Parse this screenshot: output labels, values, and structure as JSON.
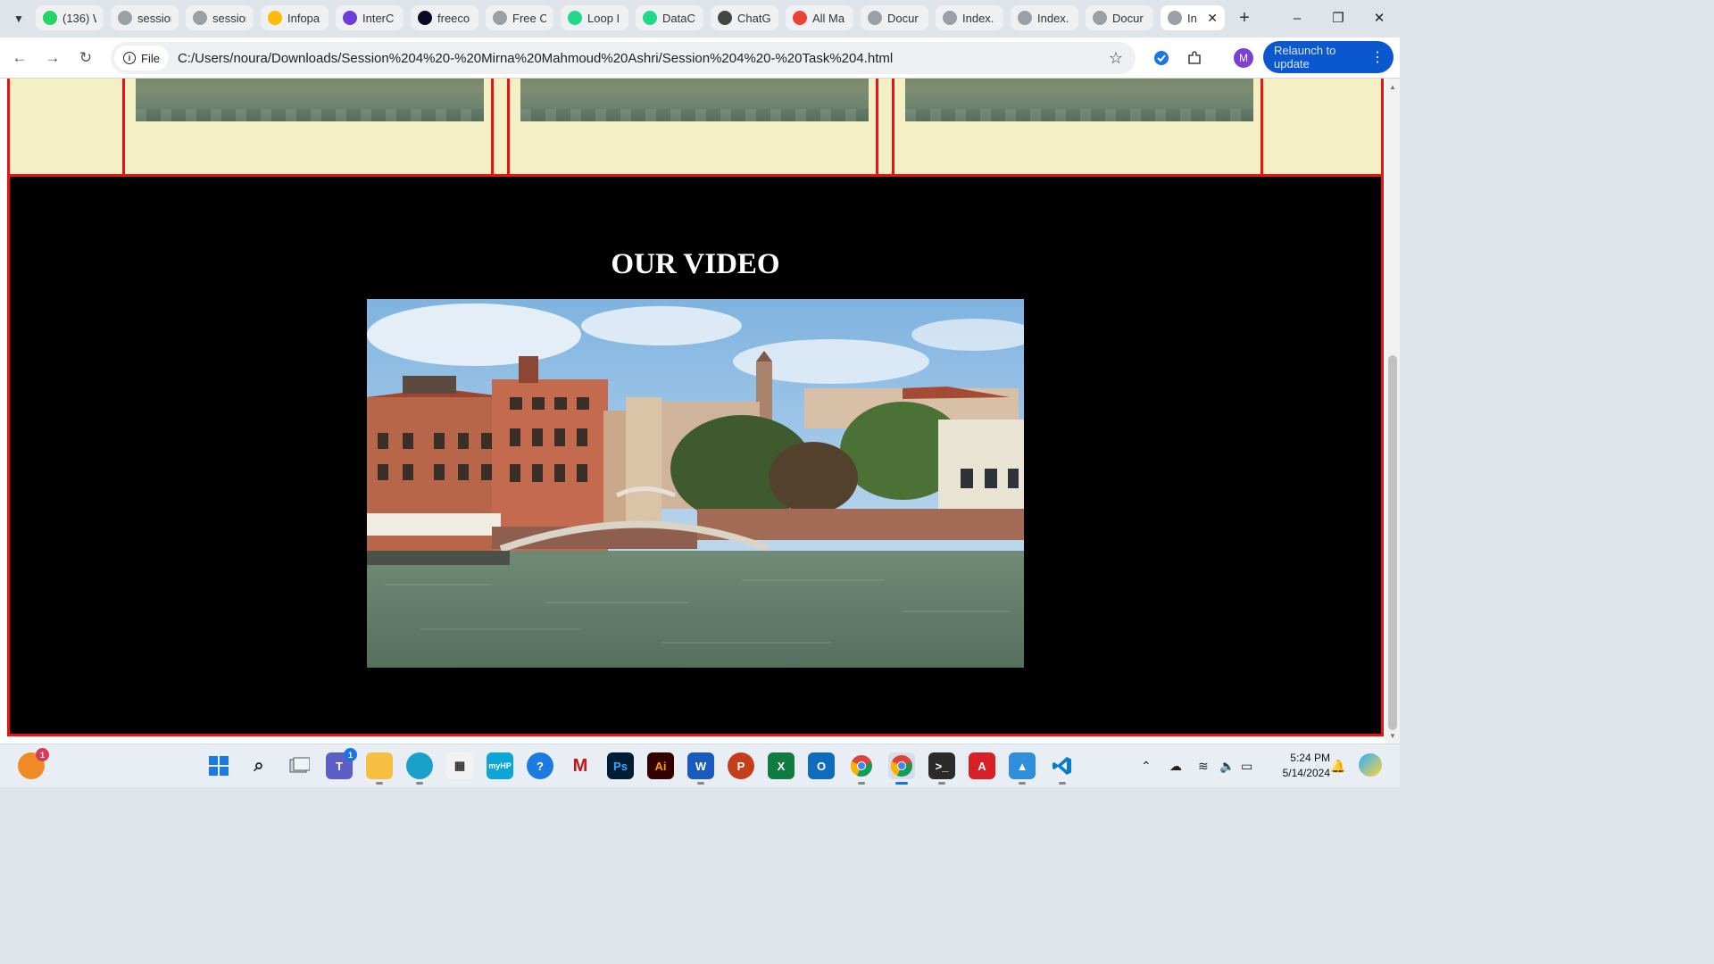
{
  "browser": {
    "tabs": [
      {
        "label": "(136) W",
        "favicon": "whatsapp-icon",
        "color": "#25d366"
      },
      {
        "label": "session",
        "favicon": "globe-icon",
        "color": "#9aa0a6"
      },
      {
        "label": "session",
        "favicon": "globe-icon",
        "color": "#9aa0a6"
      },
      {
        "label": "Infopa",
        "favicon": "google-drive-icon",
        "color": "#fbbc04"
      },
      {
        "label": "InterC",
        "favicon": "list-icon",
        "color": "#6b3fd6"
      },
      {
        "label": "freeco",
        "favicon": "freecodecamp-icon",
        "color": "#0a0a23"
      },
      {
        "label": "Free C",
        "favicon": "globe-icon",
        "color": "#9aa0a6"
      },
      {
        "label": "Loop I",
        "favicon": "pycharm-icon",
        "color": "#21d789"
      },
      {
        "label": "DataC",
        "favicon": "pycharm-icon",
        "color": "#21d789"
      },
      {
        "label": "ChatG",
        "favicon": "chatgpt-icon",
        "color": "#444444"
      },
      {
        "label": "All Ma",
        "favicon": "gmail-icon",
        "color": "#ea4335"
      },
      {
        "label": "Docur",
        "favicon": "globe-icon",
        "color": "#9aa0a6"
      },
      {
        "label": "Index.",
        "favicon": "globe-icon",
        "color": "#9aa0a6"
      },
      {
        "label": "Index.",
        "favicon": "globe-icon",
        "color": "#9aa0a6"
      },
      {
        "label": "Docur",
        "favicon": "globe-icon",
        "color": "#9aa0a6"
      }
    ],
    "active_tab": {
      "label": "In",
      "favicon": "globe-icon"
    },
    "new_tab_symbol": "+",
    "address": {
      "scheme_chip": "File",
      "url": "C:/Users/noura/Downloads/Session%204%20-%20Mirna%20Mahmoud%20Ashri/Session%204%20-%20Task%204.html"
    },
    "profile_initial": "M",
    "relaunch_label": "Relaunch to update",
    "window_controls": {
      "minimize": "–",
      "restore": "❐",
      "close": "✕"
    }
  },
  "page": {
    "video_section_title": "OUR VIDEO",
    "colors": {
      "border": "#ee1111",
      "gallery_bg": "#f5f0c4",
      "video_bg": "#000000"
    }
  },
  "taskbar": {
    "apps": [
      "firefox-icon",
      "windows-start-icon",
      "search-icon",
      "task-view-icon",
      "teams-icon",
      "file-explorer-icon",
      "edge-icon",
      "microsoft-store-icon",
      "myhp-icon",
      "help-icon",
      "mcafee-icon",
      "photoshop-icon",
      "illustrator-icon",
      "word-icon",
      "powerpoint-icon",
      "excel-icon",
      "outlook-icon",
      "chrome-icon",
      "chrome-profile-icon",
      "terminal-icon",
      "acrobat-icon",
      "photos-icon",
      "vscode-icon"
    ],
    "firefox_badge": "1",
    "teams_badge": "1",
    "time": "5:24 PM",
    "date": "5/14/2024"
  }
}
